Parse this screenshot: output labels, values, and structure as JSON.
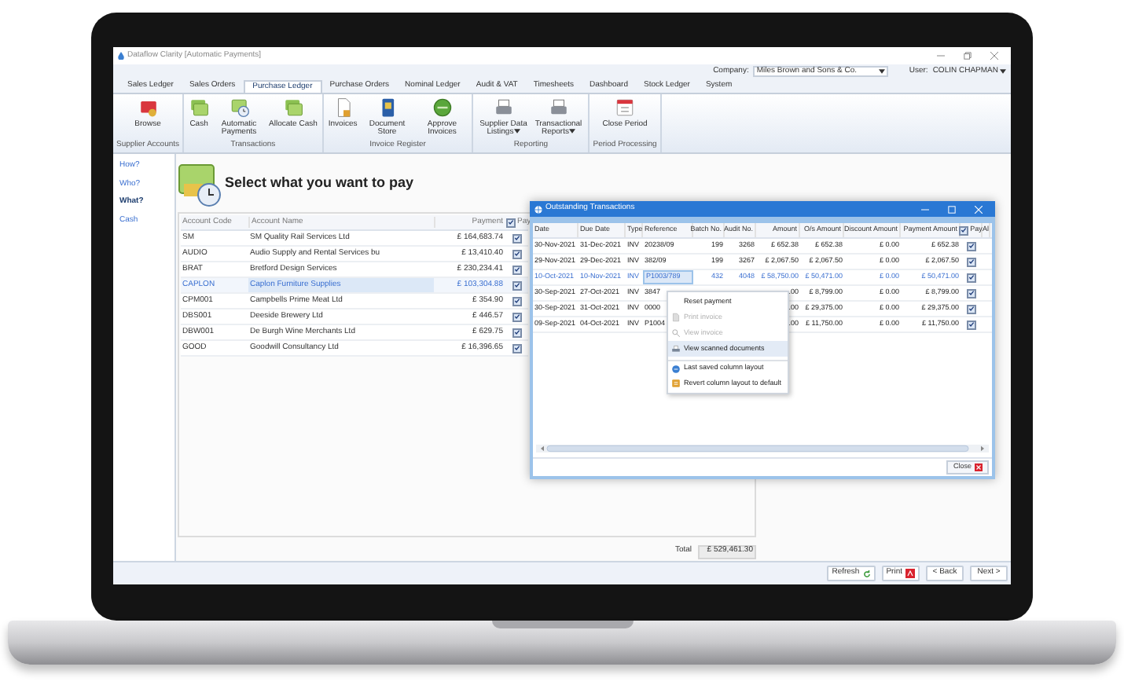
{
  "window": {
    "title": "Dataflow Clarity [Automatic Payments]"
  },
  "header": {
    "company_label": "Company:",
    "company": "Miles Brown and Sons & Co.",
    "user_label": "User:",
    "user": "COLIN CHAPMAN"
  },
  "tabs": [
    {
      "label": "Sales Ledger",
      "selected": false
    },
    {
      "label": "Sales Orders",
      "selected": false
    },
    {
      "label": "Purchase Ledger",
      "selected": true
    },
    {
      "label": "Purchase Orders",
      "selected": false
    },
    {
      "label": "Nominal Ledger",
      "selected": false
    },
    {
      "label": "Audit & VAT",
      "selected": false
    },
    {
      "label": "Timesheets",
      "selected": false
    },
    {
      "label": "Dashboard",
      "selected": false
    },
    {
      "label": "Stock Ledger",
      "selected": false
    },
    {
      "label": "System",
      "selected": false
    }
  ],
  "ribbon": {
    "groups": [
      {
        "label": "Supplier Accounts",
        "buttons": [
          {
            "label": "Browse",
            "dropdown": false
          }
        ]
      },
      {
        "label": "Transactions",
        "buttons": [
          {
            "label": "Cash",
            "dropdown": false
          },
          {
            "label": "Automatic Payments",
            "dropdown": false
          },
          {
            "label": "Allocate Cash",
            "dropdown": false
          }
        ]
      },
      {
        "label": "Invoice Register",
        "buttons": [
          {
            "label": "Invoices",
            "dropdown": false
          },
          {
            "label": "Document Store",
            "dropdown": false
          },
          {
            "label": "Approve Invoices",
            "dropdown": false
          }
        ]
      },
      {
        "label": "Reporting",
        "buttons": [
          {
            "label": "Supplier Data Listings",
            "dropdown": true
          },
          {
            "label": "Transactional Reports",
            "dropdown": true
          }
        ]
      },
      {
        "label": "Period Processing",
        "buttons": [
          {
            "label": "Close Period",
            "dropdown": false
          }
        ]
      }
    ]
  },
  "nav": [
    {
      "label": "How?",
      "selected": false
    },
    {
      "label": "Who?",
      "selected": false
    },
    {
      "label": "What?",
      "selected": true
    },
    {
      "label": "Cash",
      "selected": false
    }
  ],
  "page": {
    "heading": "Select what you want to pay",
    "table": {
      "columns": [
        "Account Code",
        "Account Name",
        "Payment",
        "Pay"
      ],
      "pay_all": true,
      "rows": [
        {
          "code": "SM",
          "name": "SM Quality Rail Services Ltd",
          "payment": "£ 164,683.74",
          "pay": true,
          "selected": false
        },
        {
          "code": "AUDIO",
          "name": "Audio Supply and Rental Services bu",
          "payment": "£ 13,410.40",
          "pay": true,
          "selected": false
        },
        {
          "code": "BRAT",
          "name": "Bretford Design Services",
          "payment": "£ 230,234.41",
          "pay": true,
          "selected": false
        },
        {
          "code": "CAPLON",
          "name": "Caplon Furniture Supplies",
          "payment": "£ 103,304.88",
          "pay": true,
          "selected": true
        },
        {
          "code": "CPM001",
          "name": "Campbells Prime Meat Ltd",
          "payment": "£ 354.90",
          "pay": true,
          "selected": false
        },
        {
          "code": "DBS001",
          "name": "Deeside Brewery Ltd",
          "payment": "£ 446.57",
          "pay": true,
          "selected": false
        },
        {
          "code": "DBW001",
          "name": "De Burgh Wine Merchants Ltd",
          "payment": "£ 629.75",
          "pay": true,
          "selected": false
        },
        {
          "code": "GOOD",
          "name": "Goodwill Consultancy Ltd",
          "payment": "£ 16,396.65",
          "pay": true,
          "selected": false
        }
      ]
    },
    "total_label": "Total",
    "total": "£ 529,461.30"
  },
  "dialog": {
    "title": "Outstanding Transactions",
    "columns": [
      "Date",
      "Due Date",
      "Type",
      "Reference",
      "Batch No.",
      "Audit No.",
      "Amount",
      "O/s Amount",
      "Discount Amount",
      "Payment Amount",
      "Pay",
      "Al"
    ],
    "pay_all": true,
    "rows": [
      {
        "date": "30-Nov-2021",
        "due": "31-Dec-2021",
        "type": "INV",
        "ref": "20238/09",
        "batch": "199",
        "audit": "3268",
        "amount": "£ 652.38",
        "os": "£ 652.38",
        "discount": "£ 0.00",
        "payment": "£ 652.38",
        "pay": true,
        "selected": false
      },
      {
        "date": "29-Nov-2021",
        "due": "29-Dec-2021",
        "type": "INV",
        "ref": "382/09",
        "batch": "199",
        "audit": "3267",
        "amount": "£ 2,067.50",
        "os": "£ 2,067.50",
        "discount": "£ 0.00",
        "payment": "£ 2,067.50",
        "pay": true,
        "selected": false
      },
      {
        "date": "10-Oct-2021",
        "due": "10-Nov-2021",
        "type": "INV",
        "ref": "P1003/789",
        "batch": "432",
        "audit": "4048",
        "amount": "£ 58,750.00",
        "os": "£ 50,471.00",
        "discount": "£ 0.00",
        "payment": "£ 50,471.00",
        "pay": true,
        "selected": true
      },
      {
        "date": "30-Sep-2021",
        "due": "27-Oct-2021",
        "type": "INV",
        "ref": "3847",
        "amount": ".00",
        "os": "£ 8,799.00",
        "discount": "£ 0.00",
        "payment": "£ 8,799.00",
        "pay": true,
        "selected": false
      },
      {
        "date": "30-Sep-2021",
        "due": "31-Oct-2021",
        "type": "INV",
        "ref": "0000",
        "amount": ".00",
        "os": "£ 29,375.00",
        "discount": "£ 0.00",
        "payment": "£ 29,375.00",
        "pay": true,
        "selected": false
      },
      {
        "date": "09-Sep-2021",
        "due": "04-Oct-2021",
        "type": "INV",
        "ref": "P1004",
        "amount": ".00",
        "os": "£ 11,750.00",
        "discount": "£ 0.00",
        "payment": "£ 11,750.00",
        "pay": true,
        "selected": false
      }
    ],
    "close": "Close"
  },
  "context_menu": [
    {
      "label": "Reset payment",
      "disabled": false,
      "selected": false,
      "divider_before": false
    },
    {
      "label": "Print invoice",
      "disabled": true,
      "selected": false,
      "divider_before": false
    },
    {
      "label": "View invoice",
      "disabled": true,
      "selected": false,
      "divider_before": false
    },
    {
      "label": "View scanned documents",
      "disabled": false,
      "selected": true,
      "divider_before": false
    },
    {
      "label": "Last saved column layout",
      "disabled": false,
      "selected": false,
      "divider_before": true
    },
    {
      "label": "Revert column layout to default",
      "disabled": false,
      "selected": false,
      "divider_before": false
    }
  ],
  "footer": [
    "Refresh",
    "Print",
    "< Back",
    "Next >"
  ]
}
